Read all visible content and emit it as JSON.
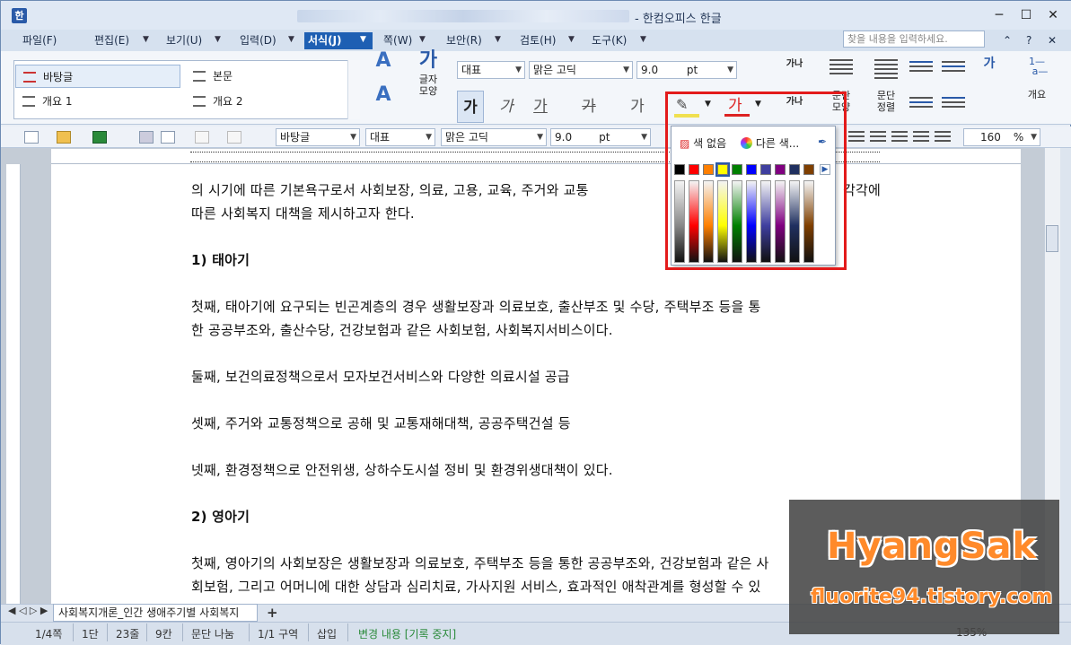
{
  "window": {
    "title": "- 한컴오피스 한글",
    "min": "─",
    "max": "☐",
    "close": "✕"
  },
  "menu": {
    "items": [
      "파일(F)",
      "편집(E)",
      "보기(U)",
      "입력(D)",
      "서식(J)",
      "쪽(W)",
      "보안(R)",
      "검토(H)",
      "도구(K)"
    ],
    "search_placeholder": "찾을 내용을 입력하세요.",
    "help": "?"
  },
  "ribbon": {
    "styles": [
      {
        "label": "바탕글"
      },
      {
        "label": "본문"
      },
      {
        "label": "개요 1"
      },
      {
        "label": "개요 2"
      }
    ],
    "char_shape_label": "글자\n모양",
    "char_shape_l1": "글자",
    "char_shape_l2": "모양",
    "lang_combo": "대표",
    "font_combo": "맑은 고딕",
    "size_combo": "9.0",
    "size_unit": "pt",
    "bold": "가",
    "italic": "가",
    "underline": "가",
    "strike": "가",
    "outline": "가",
    "fontcolor": "가",
    "para_shape_l1": "문단",
    "para_shape_l2": "모양",
    "para_num_l1": "문단",
    "para_num_l2": "정렬",
    "outline_label": "개요",
    "ga_na": "가나"
  },
  "toolbar2": {
    "style_combo": "바탕글",
    "lang_combo": "대표",
    "font_combo": "맑은 고딕",
    "size_combo": "9.0",
    "size_unit": "pt",
    "line_spacing": "160",
    "line_unit": "%"
  },
  "color_popup": {
    "no_color": "색 없음",
    "other_colors": "다른 색...",
    "arrow": "▶"
  },
  "colors": {
    "basic": [
      "#000000",
      "#ff0000",
      "#ff7f00",
      "#ffff00",
      "#008000",
      "#0000ff",
      "#3f3f9f",
      "#800080",
      "#203060",
      "#7f3f00"
    ],
    "accent": "#1e5fb3",
    "highlight_border": "#e31b1b"
  },
  "document": {
    "lines": [
      "의 시기에 따른 기본욕구로서 사회보장, 의료, 고용, 교육, 주거와 교통",
      "따른 사회복지 대책을 제시하고자 한다.",
      "1) 태아기",
      "첫째, 태아기에 요구되는 빈곤계층의 경우 생활보장과 의료보호, 출산부조 및 수당, 주택부조 등을 통",
      "한 공공부조와, 출산수당, 건강보험과 같은 사회보험, 사회복지서비스이다.",
      "둘째, 보건의료정책으로서 모자보건서비스와 다양한 의료시설 공급",
      "셋째, 주거와 교통정책으로 공해 및 교통재해대책, 공공주택건설 등",
      "넷째, 환경정책으로 안전위생, 상하수도시설 정비 및 환경위생대책이 있다.",
      "2) 영아기",
      "첫째, 영아기의 사회보장은 생활보장과 의료보호, 주택부조 등을 통한 공공부조와, 건강보험과 같은 사",
      "회보험, 그리고 어머니에 대한 상담과 심리치료, 가사지원 서비스, 효과적인 애착관계를 형성할 수 있"
    ],
    "line1_tail": "각각에"
  },
  "doc_tab": {
    "label": "사회복지개론_인간 생애주기별 사회복지",
    "add": "+"
  },
  "status": {
    "page": "1/4쪽",
    "column": "1단",
    "line": "23줄",
    "col": "9칸",
    "section": "문단 나눔",
    "area": "1/1 구역",
    "insert": "삽입",
    "track": "변경 내용 [기록 중지]",
    "zoom": "135%"
  },
  "watermark": {
    "title": "HyangSak",
    "url": "fluorite94.tistory.com"
  }
}
